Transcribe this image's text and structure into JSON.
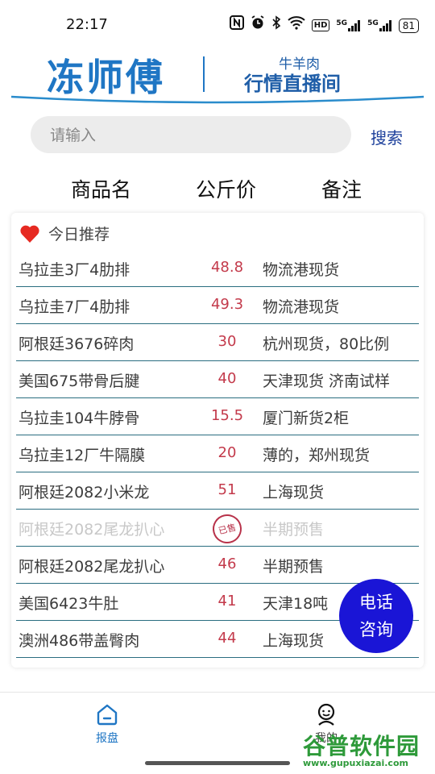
{
  "status_bar": {
    "time": "22:17",
    "icons": [
      "nfc-icon",
      "alarm-icon",
      "bluetooth-icon",
      "wifi-icon",
      "hd-icon",
      "signal-5g-icon",
      "signal-5g-icon"
    ],
    "hd_label": "HD",
    "net1": "5G",
    "net2": "5G",
    "battery": "81"
  },
  "header": {
    "logo_main": "冻师傅",
    "logo_sub1": "牛羊肉",
    "logo_sub2": "行情直播间",
    "brand_color": "#1f76c4"
  },
  "search": {
    "placeholder": "请输入",
    "button_label": "搜索"
  },
  "columns": {
    "name": "商品名",
    "price": "公斤价",
    "note": "备注"
  },
  "recommend": {
    "label": "今日推荐"
  },
  "rows": [
    {
      "name": "乌拉圭3厂4肋排",
      "price": "48.8",
      "note": "物流港现货"
    },
    {
      "name": "乌拉圭7厂4肋排",
      "price": "49.3",
      "note": "物流港现货"
    },
    {
      "name": "阿根廷3676碎肉",
      "price": "30",
      "note": "杭州现货，80比例"
    },
    {
      "name": "美国675带骨后腱",
      "price": "40",
      "note": "天津现货 济南试样"
    },
    {
      "name": "乌拉圭104牛脖骨",
      "price": "15.5",
      "note": "厦门新货2柜"
    },
    {
      "name": "乌拉圭12厂牛隔膜",
      "price": "20",
      "note": "薄的，郑州现货"
    },
    {
      "name": "阿根廷2082小米龙",
      "price": "51",
      "note": "上海现货"
    },
    {
      "name": "阿根廷2082尾龙扒心",
      "price": "",
      "note": "半期预售",
      "stamp": "已售"
    },
    {
      "name": "阿根廷2082尾龙扒心",
      "price": "46",
      "note": "半期预售"
    },
    {
      "name": "美国6423牛肚",
      "price": "41",
      "note": "天津18吨"
    },
    {
      "name": "澳洲486带盖臀肉",
      "price": "44",
      "note": "上海现货"
    }
  ],
  "call_button": {
    "line1": "电话",
    "line2": "咨询",
    "color": "#1a15d6"
  },
  "bottom_nav": {
    "items": [
      {
        "label": "报盘",
        "icon": "home-icon",
        "active": true
      },
      {
        "label": "我的",
        "icon": "profile-icon",
        "active": false
      }
    ],
    "active_color": "#1f76c4"
  },
  "watermark": {
    "title": "谷普软件园",
    "url": "www.gupuxiazai.com"
  }
}
